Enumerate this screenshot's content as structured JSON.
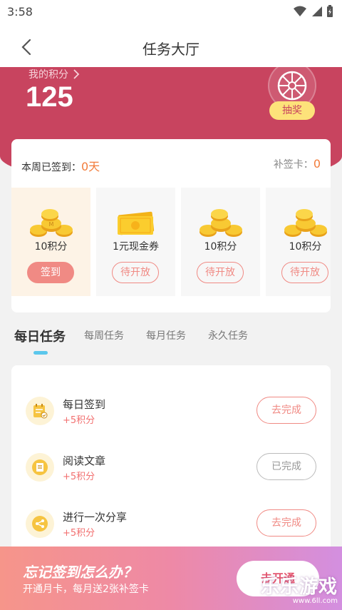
{
  "status_bar": {
    "time": "3:58"
  },
  "header": {
    "title": "任务大厅"
  },
  "points": {
    "label": "我的积分",
    "value": "125",
    "lottery_label": "抽奖"
  },
  "signin": {
    "week_label": "本周已签到：",
    "week_value": "0天",
    "makeup_label": "补签卡：",
    "makeup_value": "0",
    "days": [
      {
        "reward": "10积分",
        "button": "签到",
        "icon": "coins-icon"
      },
      {
        "reward": "1元现金券",
        "button": "待开放",
        "icon": "cash-coupon-icon"
      },
      {
        "reward": "10积分",
        "button": "待开放",
        "icon": "coins-icon"
      },
      {
        "reward": "10积分",
        "button": "待开放",
        "icon": "coins-icon"
      }
    ]
  },
  "tabs": [
    "每日任务",
    "每周任务",
    "每月任务",
    "永久任务"
  ],
  "tasks": [
    {
      "title": "每日签到",
      "reward": "+5积分",
      "button": "去完成",
      "icon": "calendar-check-icon"
    },
    {
      "title": "阅读文章",
      "reward": "+5积分",
      "button": "已完成",
      "icon": "document-icon"
    },
    {
      "title": "进行一次分享",
      "reward": "+5积分",
      "button": "去完成",
      "icon": "share-icon"
    }
  ],
  "promo": {
    "title": "忘记签到怎么办？",
    "subtitle": "开通月卡，每月送2张补签卡",
    "button": "去开通"
  },
  "watermark": {
    "main": "乐乐游戏",
    "url": "www.6ll.com"
  },
  "colors": {
    "accent": "#c8445f",
    "orange": "#f27c3b",
    "button_pink": "#f08a84",
    "tab_indicator": "#5bc7ec"
  }
}
